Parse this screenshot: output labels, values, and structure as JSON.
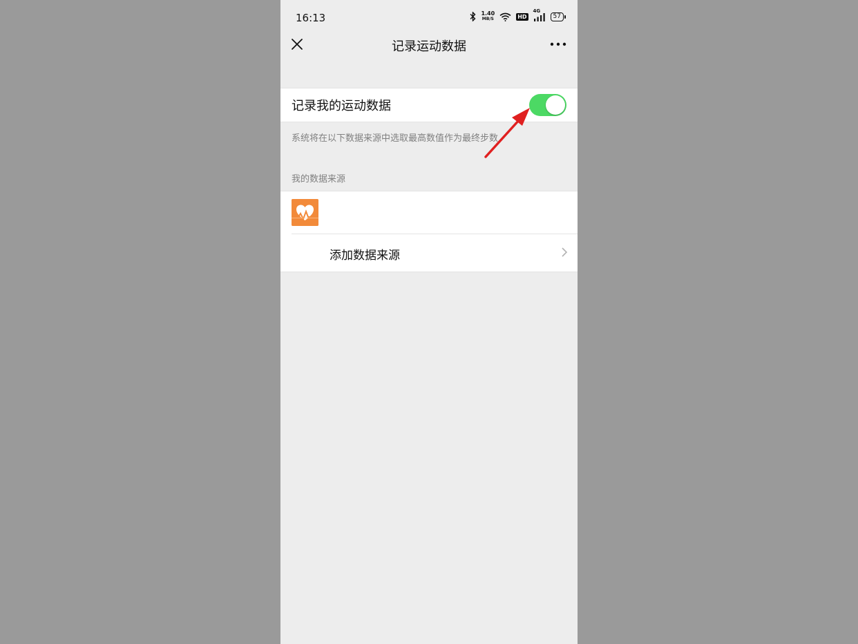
{
  "status_bar": {
    "time": "16:13",
    "net_speed_value": "1.40",
    "net_speed_unit": "MB/S",
    "hd": "HD",
    "network": "4G",
    "battery": "57"
  },
  "nav": {
    "title": "记录运动数据",
    "close_icon": "close-icon",
    "more_icon": "more-icon"
  },
  "toggle_row": {
    "label": "记录我的运动数据",
    "enabled": true
  },
  "hint": "系统将在以下数据来源中选取最高数值作为最终步数",
  "data_sources": {
    "title": "我的数据来源",
    "items": [
      {
        "icon": "health-heart-icon"
      }
    ],
    "add_label": "添加数据来源"
  },
  "colors": {
    "toggle_on": "#4cd964",
    "app_icon": "#f28a3a",
    "annotation_arrow": "#e02020"
  }
}
